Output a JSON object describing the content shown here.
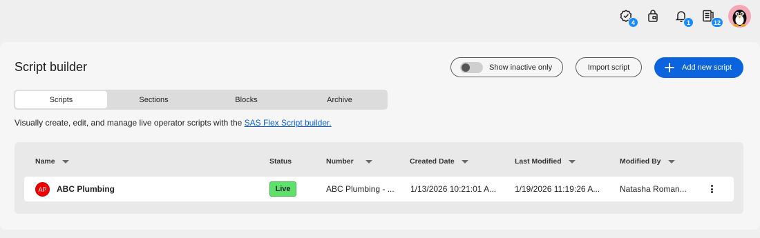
{
  "topbar": {
    "icons": [
      {
        "name": "award-check-icon",
        "badge": "4"
      },
      {
        "name": "lock-bag-icon",
        "badge": ""
      },
      {
        "name": "bell-icon",
        "badge": "1"
      },
      {
        "name": "notes-icon",
        "badge": "12"
      }
    ]
  },
  "page": {
    "title": "Script builder",
    "toggle_label": "Show inactive only",
    "import_label": "Import script",
    "add_label": "Add new script"
  },
  "tabs": [
    "Scripts",
    "Sections",
    "Blocks",
    "Archive"
  ],
  "active_tab": "Scripts",
  "description": {
    "text": "Visually create, edit, and manage live operator scripts with the ",
    "link": "SAS Flex Script builder."
  },
  "table": {
    "columns": [
      "Name",
      "Status",
      "Number",
      "Created Date",
      "Last Modified",
      "Modified By"
    ],
    "rows": [
      {
        "initials": "AP",
        "name": "ABC Plumbing",
        "status": "Live",
        "number": "ABC Plumbing - ...",
        "created": "1/13/2026 10:21:01 A...",
        "modified": "1/19/2026 11:19:26 A...",
        "modified_by": "Natasha Roman..."
      }
    ]
  },
  "colors": {
    "accent": "#0b64dd",
    "badge": "#1a8cff",
    "live": "#5fe06a",
    "avatar_bg": "#f6a7b6"
  }
}
